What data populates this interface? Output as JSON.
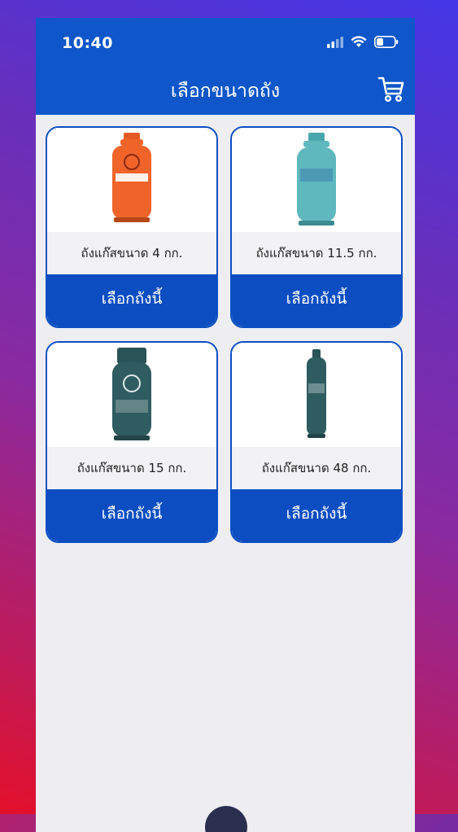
{
  "status_bar": {
    "time": "10:40"
  },
  "header": {
    "title": "เลือกขนาดถัง",
    "cart_icon": "cart-icon"
  },
  "colors": {
    "primary": "#0e56c9",
    "card_border": "#0c4ec2",
    "label_bg": "#f2f2f4"
  },
  "products": [
    {
      "label": "ถังแก๊สขนาด 4 กก.",
      "button": "เลือกถังนี้",
      "tank_color": "#f0642a"
    },
    {
      "label": "ถังแก๊สขนาด 11.5 กก.",
      "button": "เลือกถังนี้",
      "tank_color": "#5fb8bd"
    },
    {
      "label": "ถังแก๊สขนาด 15 กก.",
      "button": "เลือกถังนี้",
      "tank_color": "#2f5c60"
    },
    {
      "label": "ถังแก๊สขนาด 48 กก.",
      "button": "เลือกถังนี้",
      "tank_color": "#2f5c60"
    }
  ]
}
